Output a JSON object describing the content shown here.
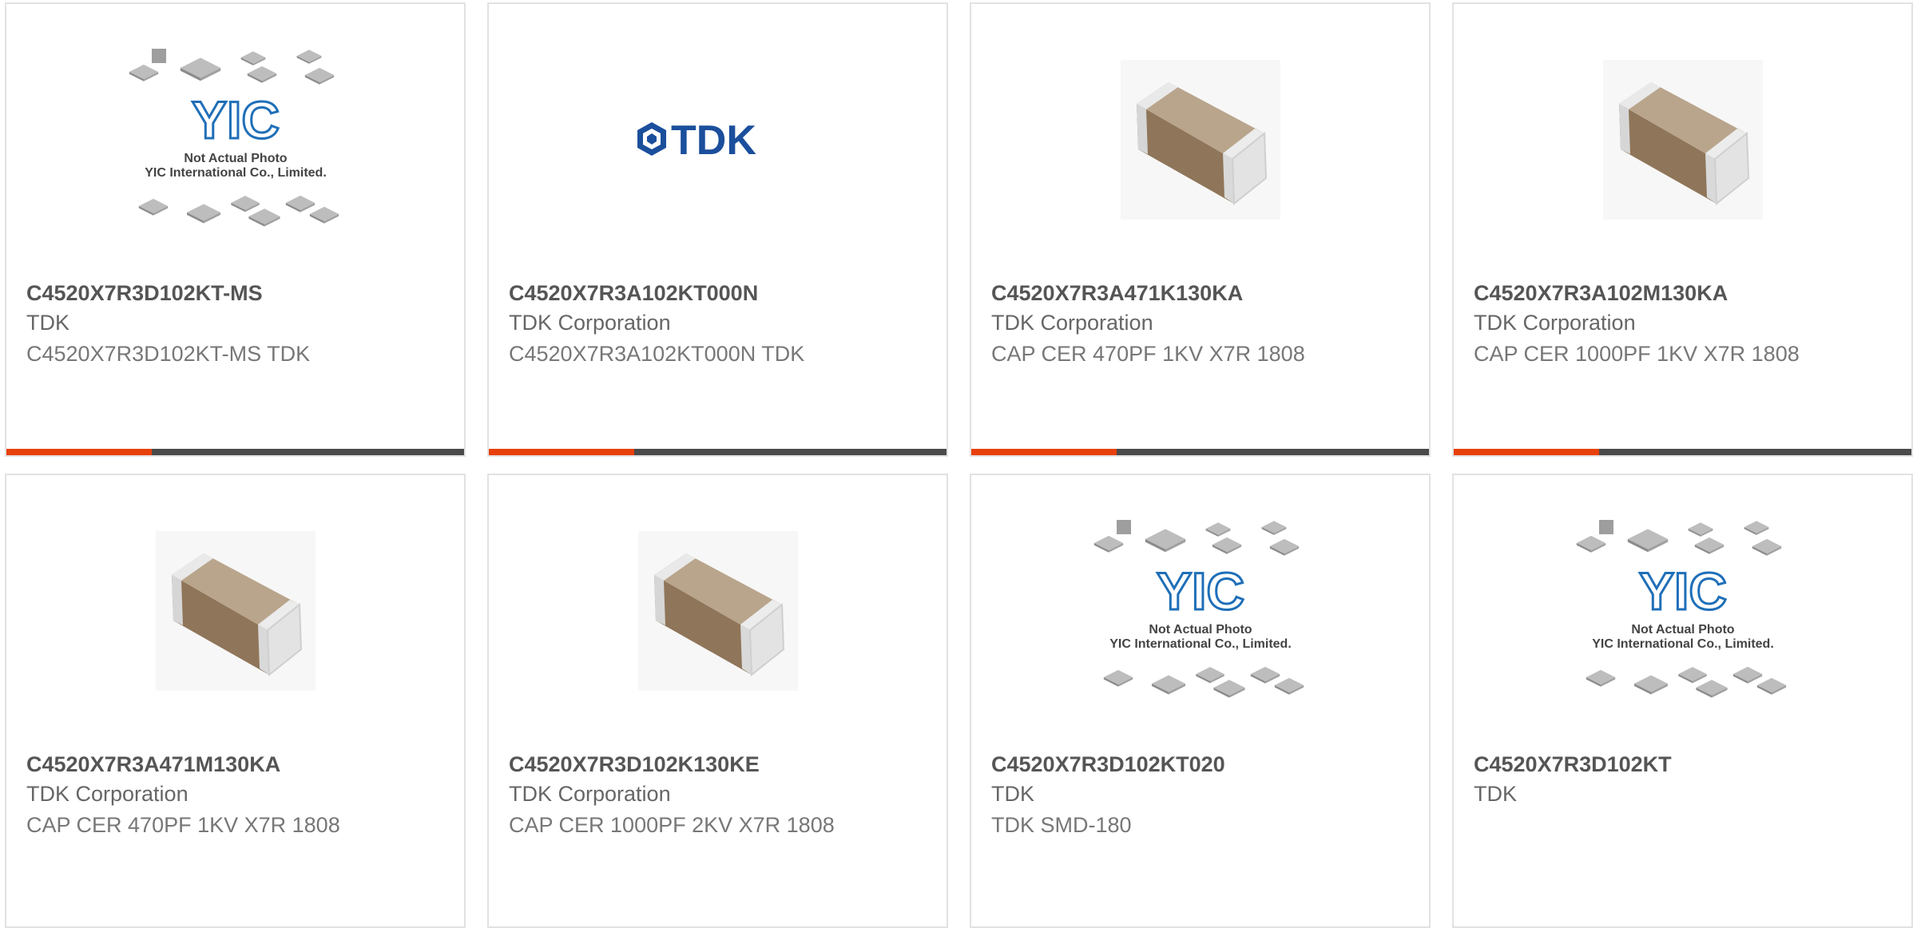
{
  "colors": {
    "accent": "#e8400c",
    "bar": "#4a4a4a",
    "tdk_blue": "#1b4f9c",
    "yic_blue": "#1f6fb8"
  },
  "cards": [
    {
      "part_number": "C4520X7R3D102KT-MS",
      "manufacturer": "TDK",
      "description": "C4520X7R3D102KT-MS TDK",
      "image": "yic-not-actual-photo"
    },
    {
      "part_number": "C4520X7R3A102KT000N",
      "manufacturer": "TDK Corporation",
      "description": "C4520X7R3A102KT000N TDK",
      "image": "tdk-logo"
    },
    {
      "part_number": "C4520X7R3A471K130KA",
      "manufacturer": "TDK Corporation",
      "description": "CAP CER 470PF 1KV X7R 1808",
      "image": "mlcc-chip"
    },
    {
      "part_number": "C4520X7R3A102M130KA",
      "manufacturer": "TDK Corporation",
      "description": "CAP CER 1000PF 1KV X7R 1808",
      "image": "mlcc-chip"
    },
    {
      "part_number": "C4520X7R3A471M130KA",
      "manufacturer": "TDK Corporation",
      "description": "CAP CER 470PF 1KV X7R 1808",
      "image": "mlcc-chip"
    },
    {
      "part_number": "C4520X7R3D102K130KE",
      "manufacturer": "TDK Corporation",
      "description": "CAP CER 1000PF 2KV X7R 1808",
      "image": "mlcc-chip"
    },
    {
      "part_number": "C4520X7R3D102KT020",
      "manufacturer": "TDK",
      "description": "TDK SMD-180",
      "image": "yic-not-actual-photo"
    },
    {
      "part_number": "C4520X7R3D102KT",
      "manufacturer": "TDK",
      "description": "",
      "image": "yic-not-actual-photo"
    }
  ],
  "yic": {
    "logo_text": "YIC",
    "caption_line1": "Not Actual Photo",
    "caption_line2": "YIC International Co., Limited."
  },
  "tdk": {
    "logo_text": "TDK"
  }
}
